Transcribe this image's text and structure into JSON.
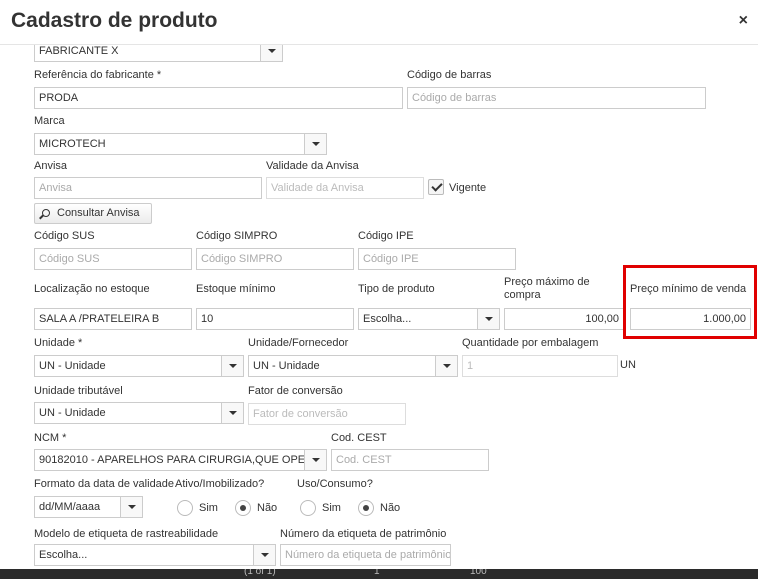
{
  "modal": {
    "title": "Cadastro de produto",
    "close": "×"
  },
  "fabricante": {
    "value": "FABRICANTE X"
  },
  "referencia": {
    "label": "Referência do fabricante *",
    "value": "PRODA"
  },
  "codigo_barras": {
    "label": "Código de barras",
    "placeholder": "Código de barras"
  },
  "marca": {
    "label": "Marca",
    "value": "MICROTECH"
  },
  "anvisa": {
    "label": "Anvisa",
    "placeholder": "Anvisa"
  },
  "validade_anvisa": {
    "label": "Validade da Anvisa",
    "placeholder": "Validade da Anvisa"
  },
  "vigente": {
    "label": "Vigente",
    "checked": true
  },
  "consultar_anvisa": {
    "label": "Consultar Anvisa"
  },
  "codigo_sus": {
    "label": "Código SUS",
    "placeholder": "Código SUS"
  },
  "codigo_simpro": {
    "label": "Código SIMPRO",
    "placeholder": "Código SIMPRO"
  },
  "codigo_ipe": {
    "label": "Código IPE",
    "placeholder": "Código IPE"
  },
  "localizacao": {
    "label": "Localização no estoque",
    "value": "SALA A /PRATELEIRA B"
  },
  "estoque_minimo": {
    "label": "Estoque mínimo",
    "value": "10"
  },
  "tipo_produto": {
    "label": "Tipo de produto",
    "value": "Escolha..."
  },
  "preco_max_compra": {
    "label": "Preço máximo de compra",
    "value": "100,00"
  },
  "preco_min_venda": {
    "label": "Preço mínimo de venda",
    "value": "1.000,00"
  },
  "unidade": {
    "label": "Unidade *",
    "value": "UN - Unidade"
  },
  "unidade_fornecedor": {
    "label": "Unidade/Fornecedor",
    "value": "UN - Unidade"
  },
  "qtd_embalagem": {
    "label": "Quantidade por embalagem",
    "placeholder": "1",
    "unit": "UN"
  },
  "unidade_tributavel": {
    "label": "Unidade tributável",
    "value": "UN - Unidade"
  },
  "fator_conversao": {
    "label": "Fator de conversão",
    "placeholder": "Fator de conversão"
  },
  "ncm": {
    "label": "NCM *",
    "value": "90182010 - APARELHOS PARA CIRURGIA,QUE OPE"
  },
  "cod_cest": {
    "label": "Cod. CEST",
    "placeholder": "Cod. CEST"
  },
  "formato_validade": {
    "label": "Formato da data de validade",
    "value": "dd/MM/aaaa"
  },
  "ativo_imobilizado": {
    "label": "Ativo/Imobilizado?",
    "sim": "Sim",
    "nao": "Não",
    "selected": "Não"
  },
  "uso_consumo": {
    "label": "Uso/Consumo?",
    "sim": "Sim",
    "nao": "Não",
    "selected": "Não"
  },
  "modelo_etiqueta": {
    "label": "Modelo de etiqueta de rastreabilidade",
    "value": "Escolha..."
  },
  "numero_patrimonio": {
    "label": "Número da etiqueta de patrimônio",
    "placeholder": "Número da etiqueta de patrimônio"
  },
  "pager": {
    "info": "(1 of 1)",
    "page": "1",
    "per_page": "100"
  }
}
